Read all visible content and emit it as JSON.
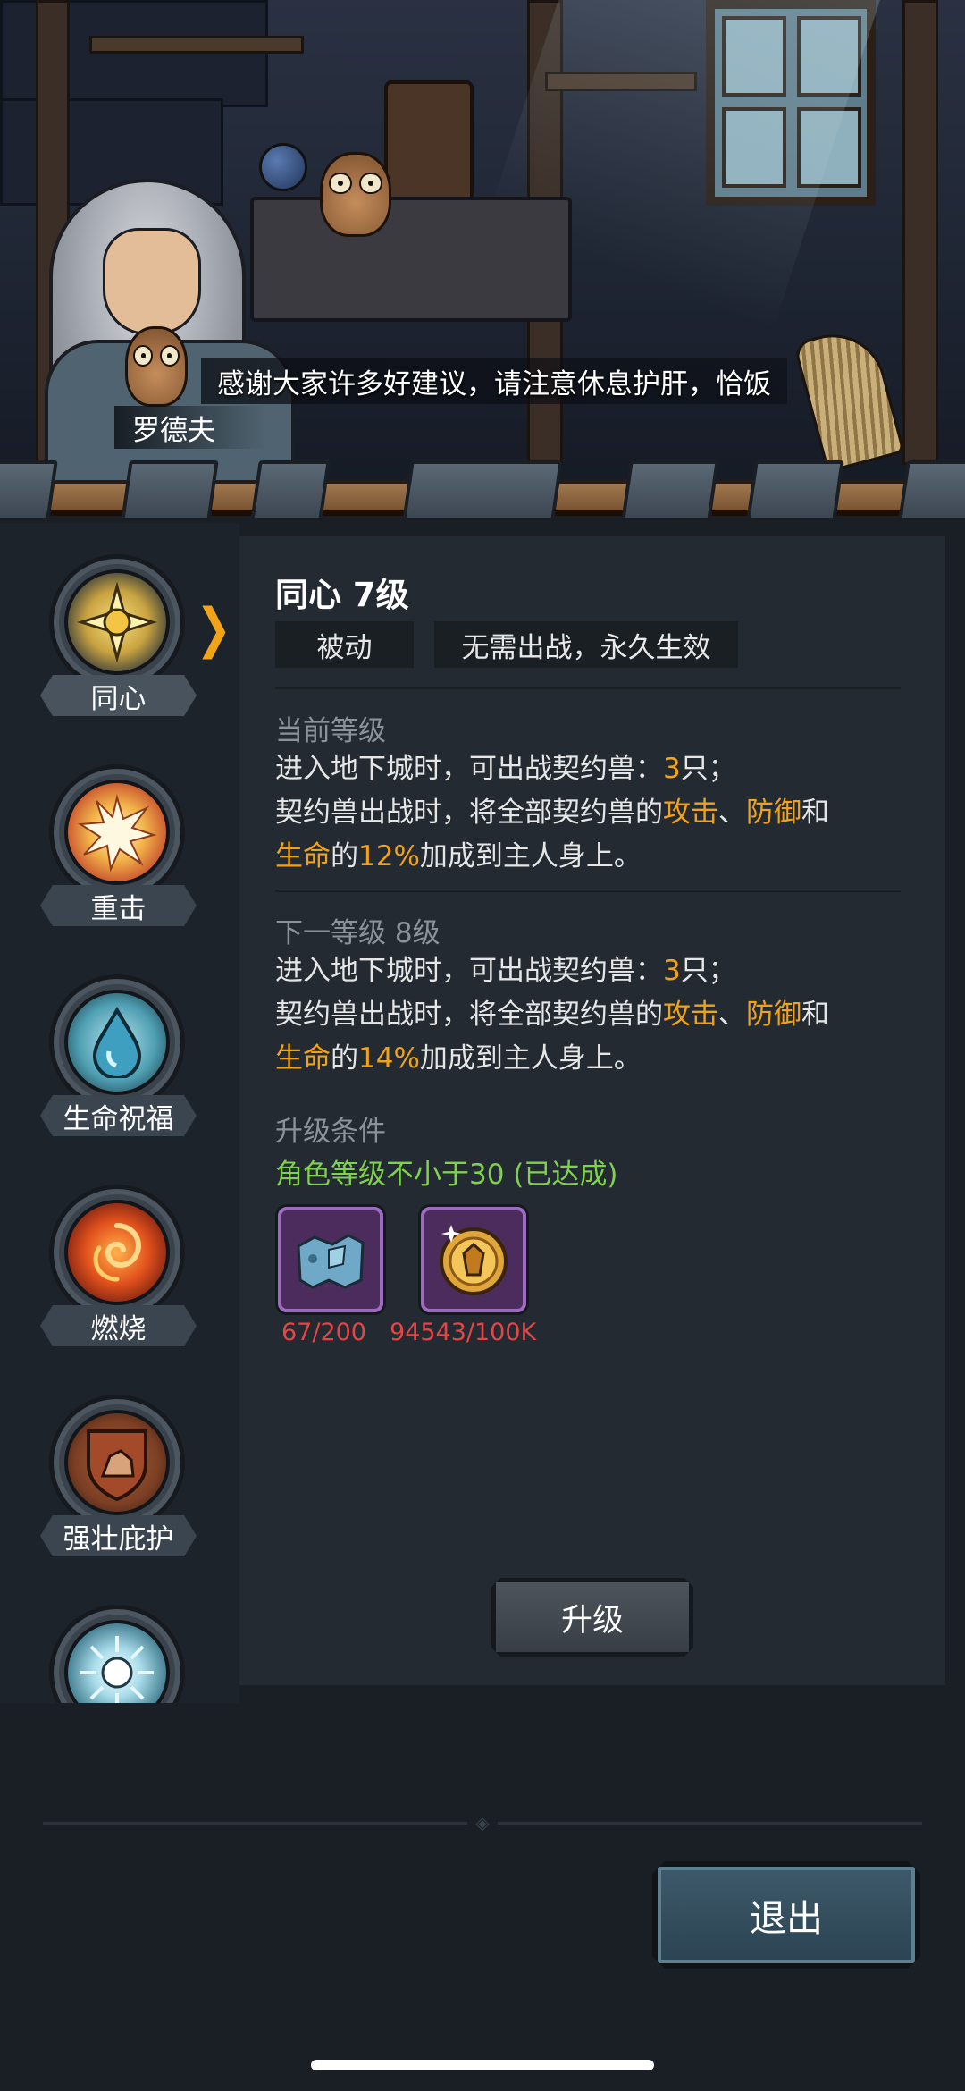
{
  "dialog": {
    "text": "感谢大家许多好建议，请注意休息护肝，恰饭",
    "speaker": "罗德夫"
  },
  "skills": [
    {
      "label": "同心",
      "icon": "sun-star-icon",
      "active": true
    },
    {
      "label": "重击",
      "icon": "burst-icon",
      "active": false
    },
    {
      "label": "生命祝福",
      "icon": "water-drop-icon",
      "active": false
    },
    {
      "label": "燃烧",
      "icon": "flame-swirl-icon",
      "active": false
    },
    {
      "label": "强壮庇护",
      "icon": "shield-rock-icon",
      "active": false
    },
    {
      "label": "",
      "icon": "radiant-burst-icon",
      "active": false
    }
  ],
  "detail": {
    "title": "同心 7级",
    "tag_type": "被动",
    "tag_effect": "无需出战，永久生效",
    "current": {
      "header": "当前等级",
      "line1_a": "进入地下城时，可出战契约兽：",
      "line1_num": "3",
      "line1_b": "只；",
      "line2_a": "契约兽出战时，将全部契约兽的",
      "attack": "攻击",
      "sep": "、",
      "defense": "防御",
      "and": "和",
      "life": "生命",
      "of": "的",
      "percent": "12%",
      "line3_b": "加成到主人身上。"
    },
    "next": {
      "header": "下一等级 8级",
      "line1_a": "进入地下城时，可出战契约兽：",
      "line1_num": "3",
      "line1_b": "只；",
      "line2_a": "契约兽出战时，将全部契约兽的",
      "attack": "攻击",
      "sep": "、",
      "defense": "防御",
      "and": "和",
      "life": "生命",
      "of": "的",
      "percent": "14%",
      "line3_b": "加成到主人身上。"
    },
    "requirements": {
      "header": "升级条件",
      "condition": "角色等级不小于30 (已达成)"
    },
    "materials": [
      {
        "icon": "scroll-map-icon",
        "count": "67/200"
      },
      {
        "icon": "gold-coin-icon",
        "count": "94543/100K"
      }
    ],
    "upgrade_label": "升级"
  },
  "footer": {
    "exit_label": "退出"
  },
  "colors": {
    "highlight": "#f0a21a",
    "requirement_met": "#7fd14e",
    "insufficient": "#e24646"
  }
}
